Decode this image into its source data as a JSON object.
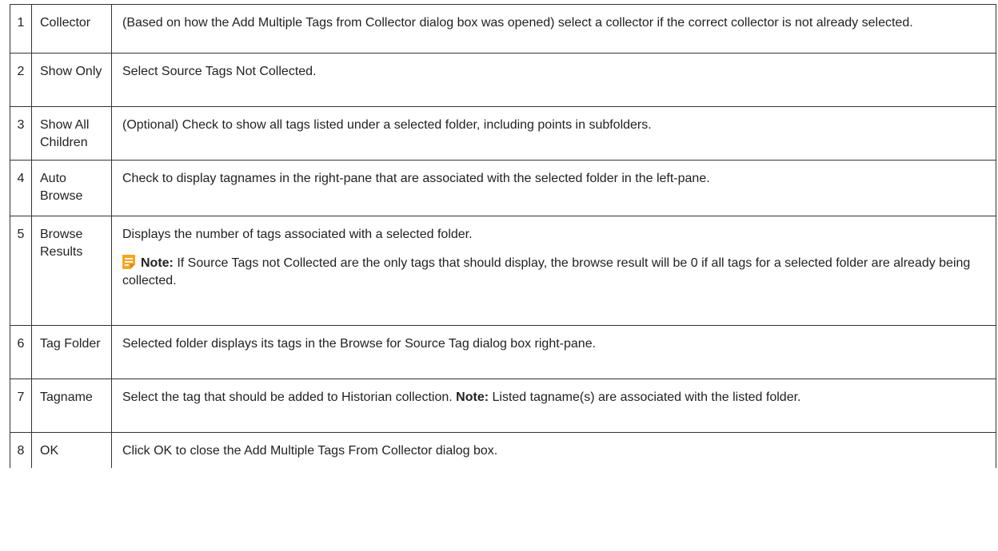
{
  "rows": [
    {
      "number": "1",
      "field": "Collector",
      "description": "(Based on how the Add Multiple Tags from Collector dialog box was opened) select a collector if the correct collector is not already selected."
    },
    {
      "number": "2",
      "field": "Show Only",
      "description": "Select Source Tags Not Collected."
    },
    {
      "number": "3",
      "field": "Show All Children",
      "description": "(Optional) Check to show all tags listed under a selected folder, including points in subfolders."
    },
    {
      "number": "4",
      "field": "Auto Browse",
      "description": "Check to display tagnames in the right-pane that are associated with the selected  folder in the left-pane."
    },
    {
      "number": "5",
      "field": "Browse Results",
      "description": "Displays the number of tags associated with a selected folder.",
      "note_label": "Note:",
      "note_text": "  If Source Tags not Collected are the only tags that should display, the browse result will be 0 if all tags for a selected folder are already being collected."
    },
    {
      "number": "6",
      "field": "Tag Folder",
      "description": "Selected folder displays its  tags in the Browse for Source Tag dialog box right-pane."
    },
    {
      "number": "7",
      "field": "Tagname",
      "description": "Select the tag that should be added to Historian collection. ",
      "note_label": "Note:",
      "note_text": " Listed tagname(s) are associated with the listed folder."
    },
    {
      "number": "8",
      "field": "OK",
      "description": "Click OK to close the Add Multiple Tags From Collector dialog box."
    }
  ],
  "icons": {
    "note": "note-icon"
  },
  "colors": {
    "note_icon": "#F5A623",
    "border": "#333333",
    "text": "#222222"
  }
}
